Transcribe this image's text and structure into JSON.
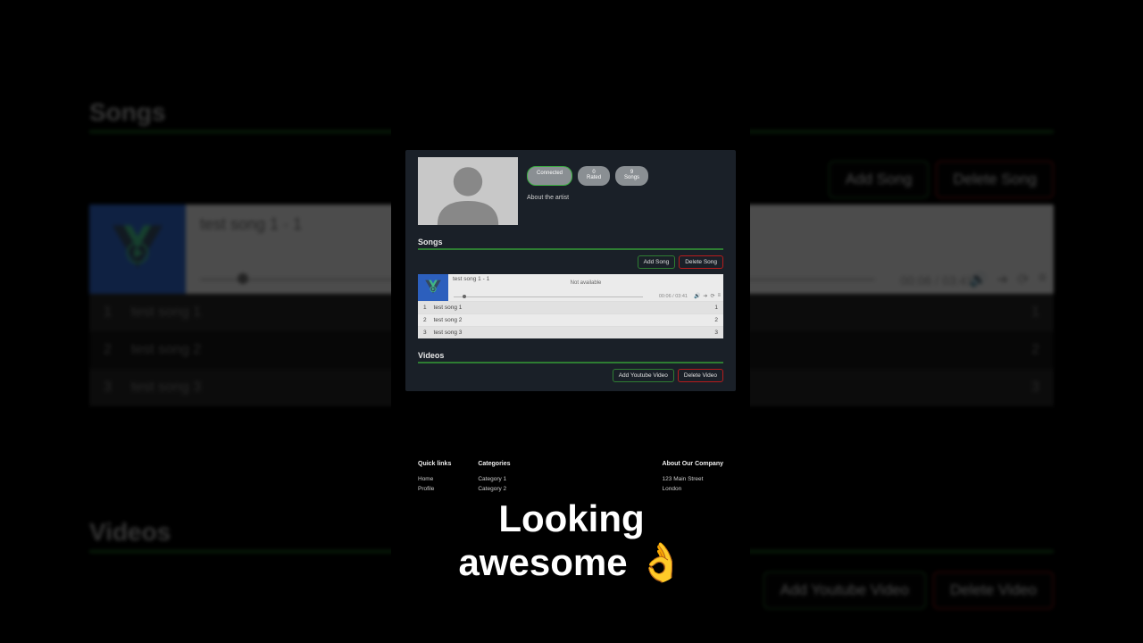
{
  "background": {
    "songs_heading": "Songs",
    "videos_heading": "Videos",
    "buttons": {
      "add_song": "Add Song",
      "delete_song": "Delete Song",
      "add_video": "Add Youtube Video",
      "delete_video": "Delete Video"
    },
    "player": {
      "title": "test song 1",
      "sep": " - ",
      "track_no": "1",
      "time": "00:06 / 03:41"
    },
    "list": [
      {
        "idx": "1",
        "title": "test song 1",
        "right": "1"
      },
      {
        "idx": "2",
        "title": "test song 2",
        "right": "2"
      },
      {
        "idx": "3",
        "title": "test song 3",
        "right": "3"
      }
    ]
  },
  "mobile": {
    "pills": {
      "connected": "Connected",
      "rated_num": "0",
      "rated_lbl": "Rated",
      "songs_num": "9",
      "songs_lbl": "Songs"
    },
    "about": "About the artist",
    "songs_heading": "Songs",
    "videos_heading": "Videos",
    "buttons": {
      "add_song": "Add Song",
      "delete_song": "Delete Song",
      "add_video": "Add Youtube Video",
      "delete_video": "Delete Video"
    },
    "player": {
      "title": "test song 1 - 1",
      "na": "Not available",
      "time": "00:06 / 03:41"
    },
    "list": [
      {
        "idx": "1",
        "title": "test song 1",
        "right": "1"
      },
      {
        "idx": "2",
        "title": "test song 2",
        "right": "2"
      },
      {
        "idx": "3",
        "title": "test song 3",
        "right": "3"
      }
    ],
    "footer": {
      "col1_h": "Quick links",
      "col1_a": "Home",
      "col1_b": "Profile",
      "col2_h": "Categories",
      "col2_a": "Category 1",
      "col2_b": "Category 2",
      "col3_h": "About Our Company",
      "col3_a": "123 Main Street",
      "col3_b": "London"
    }
  },
  "caption": {
    "line1": "Looking",
    "line2": "awesome 👌"
  }
}
